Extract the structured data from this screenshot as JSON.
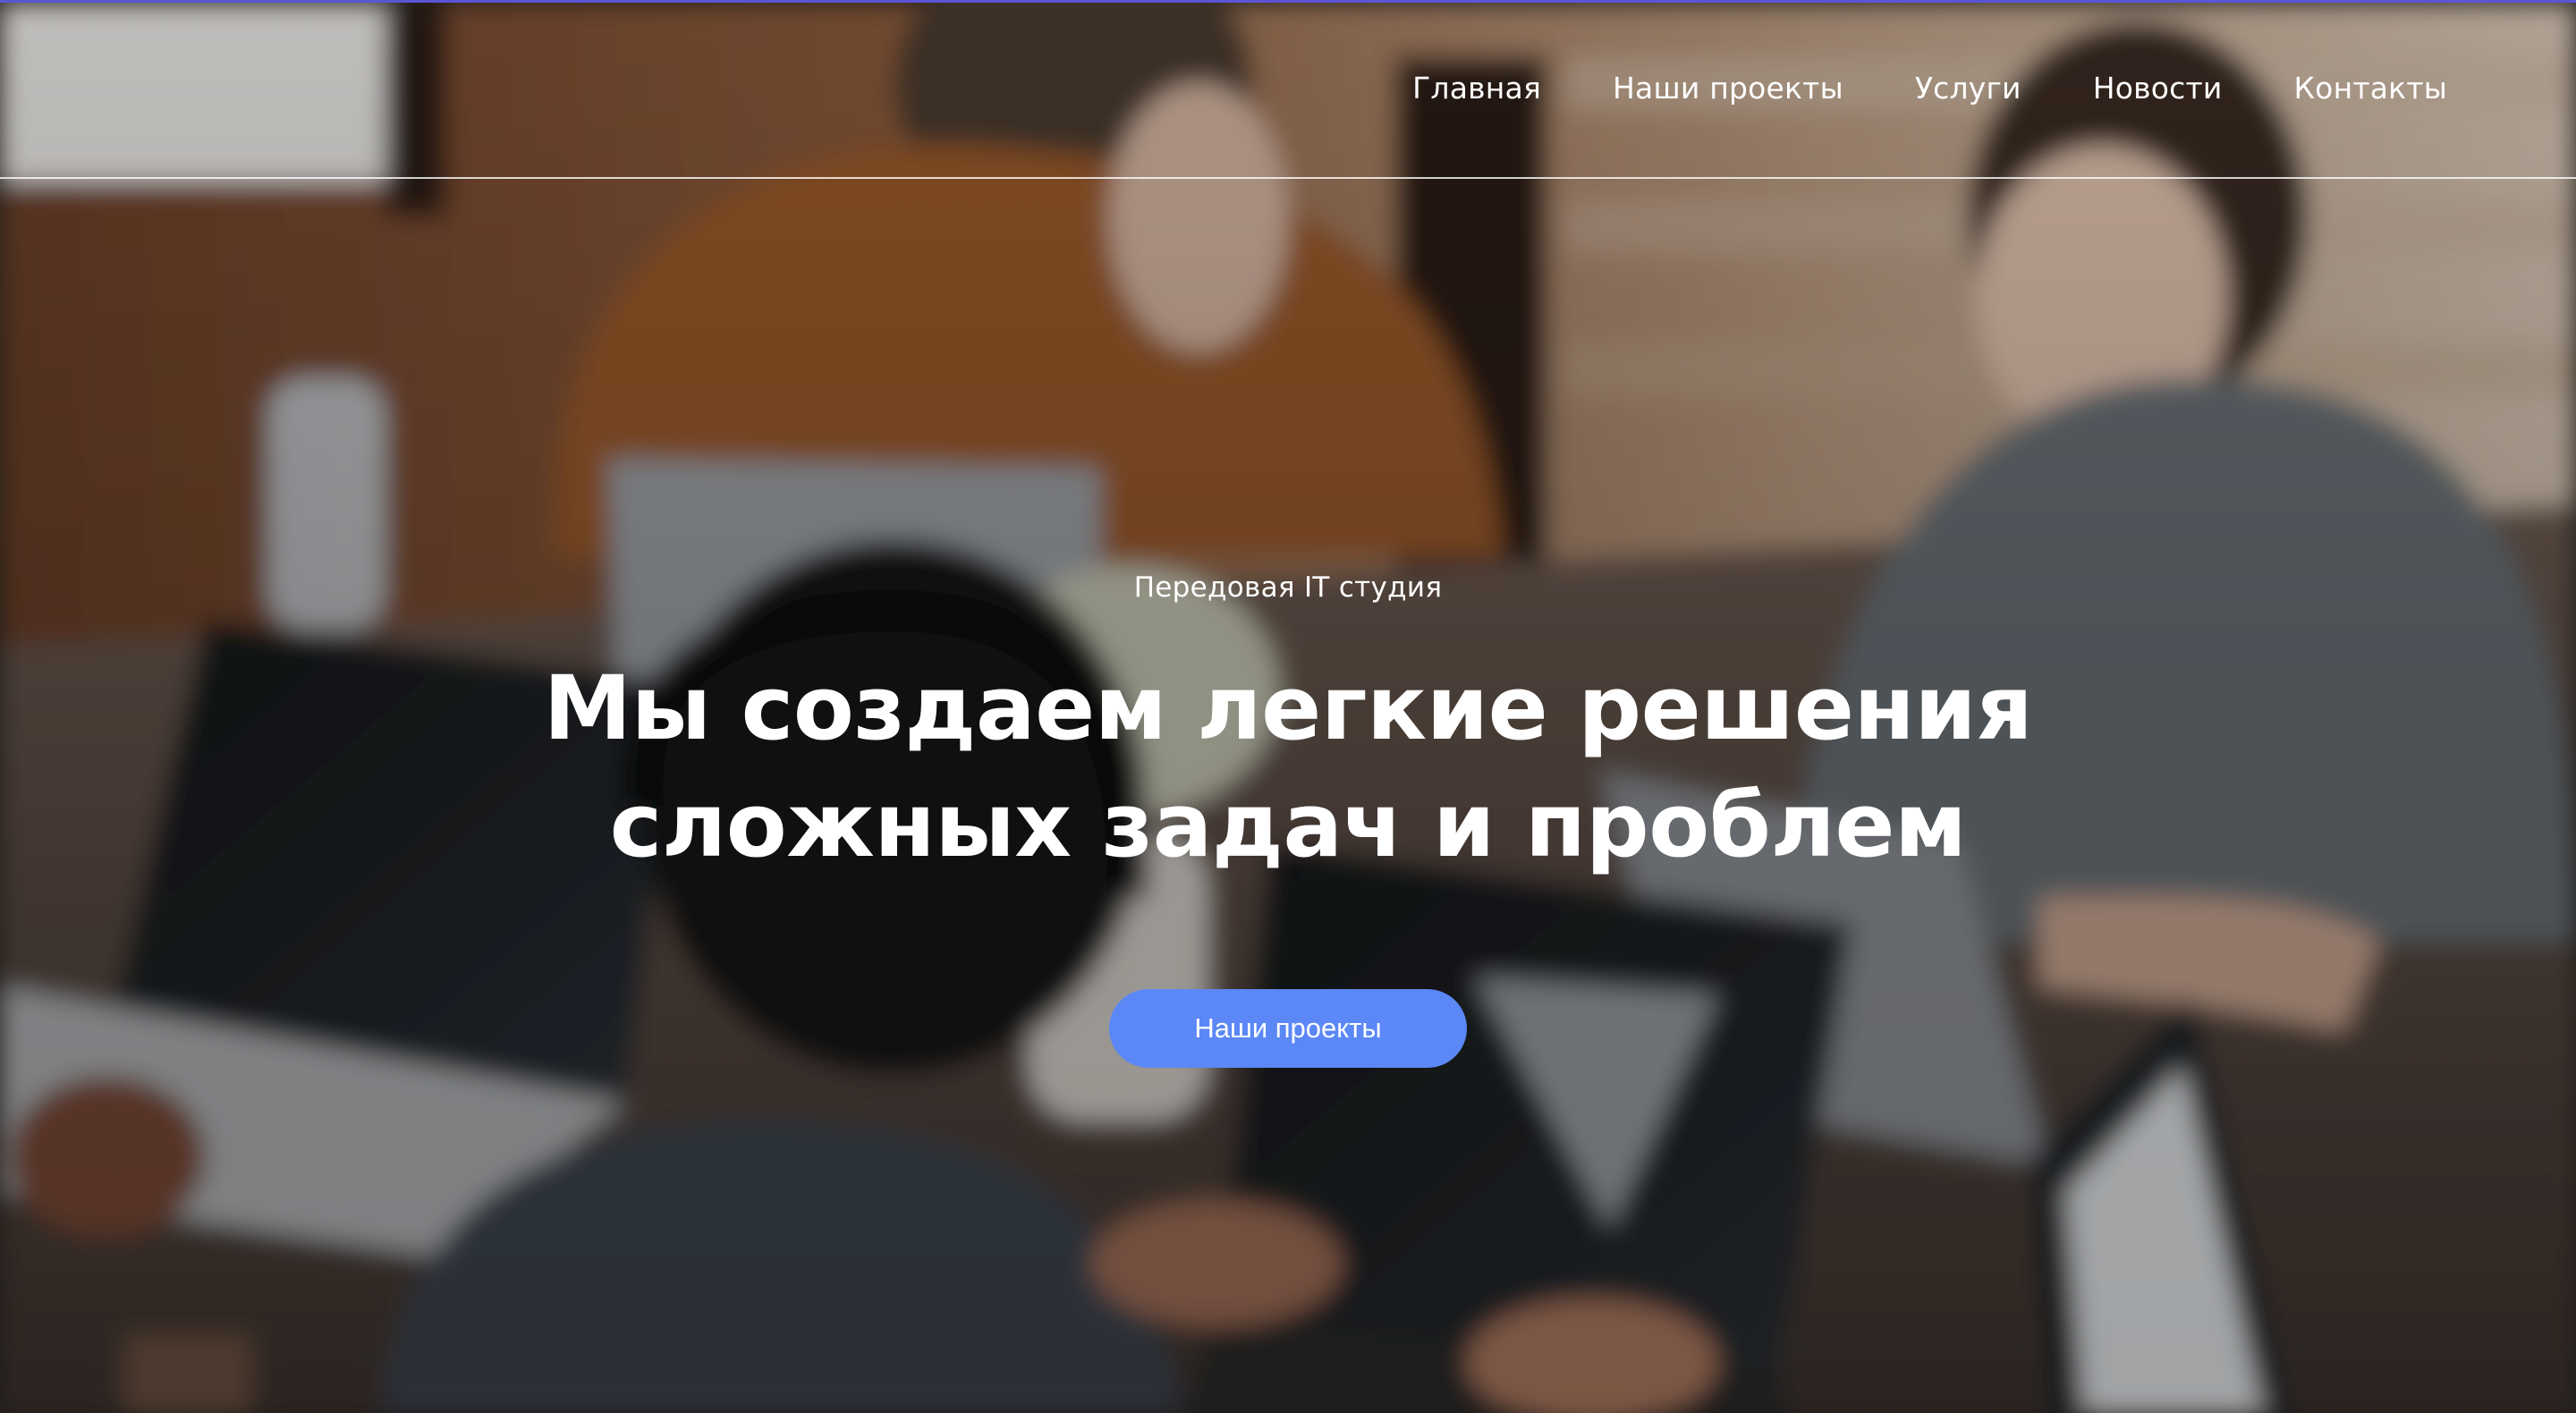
{
  "nav": {
    "items": [
      {
        "label": "Главная"
      },
      {
        "label": "Наши проекты"
      },
      {
        "label": "Услуги"
      },
      {
        "label": "Новости"
      },
      {
        "label": "Контакты"
      }
    ]
  },
  "hero": {
    "eyebrow": "Передовая IT студия",
    "headline_line1": "Мы создаем легкие решения",
    "headline_line2": "сложных задач и проблем",
    "cta_label": "Наши проекты",
    "background": "photo of people working on laptops at a wooden table"
  },
  "colors": {
    "accent_button": "#5b88f6",
    "top_border": "#5b55d6",
    "text": "#ffffff"
  }
}
